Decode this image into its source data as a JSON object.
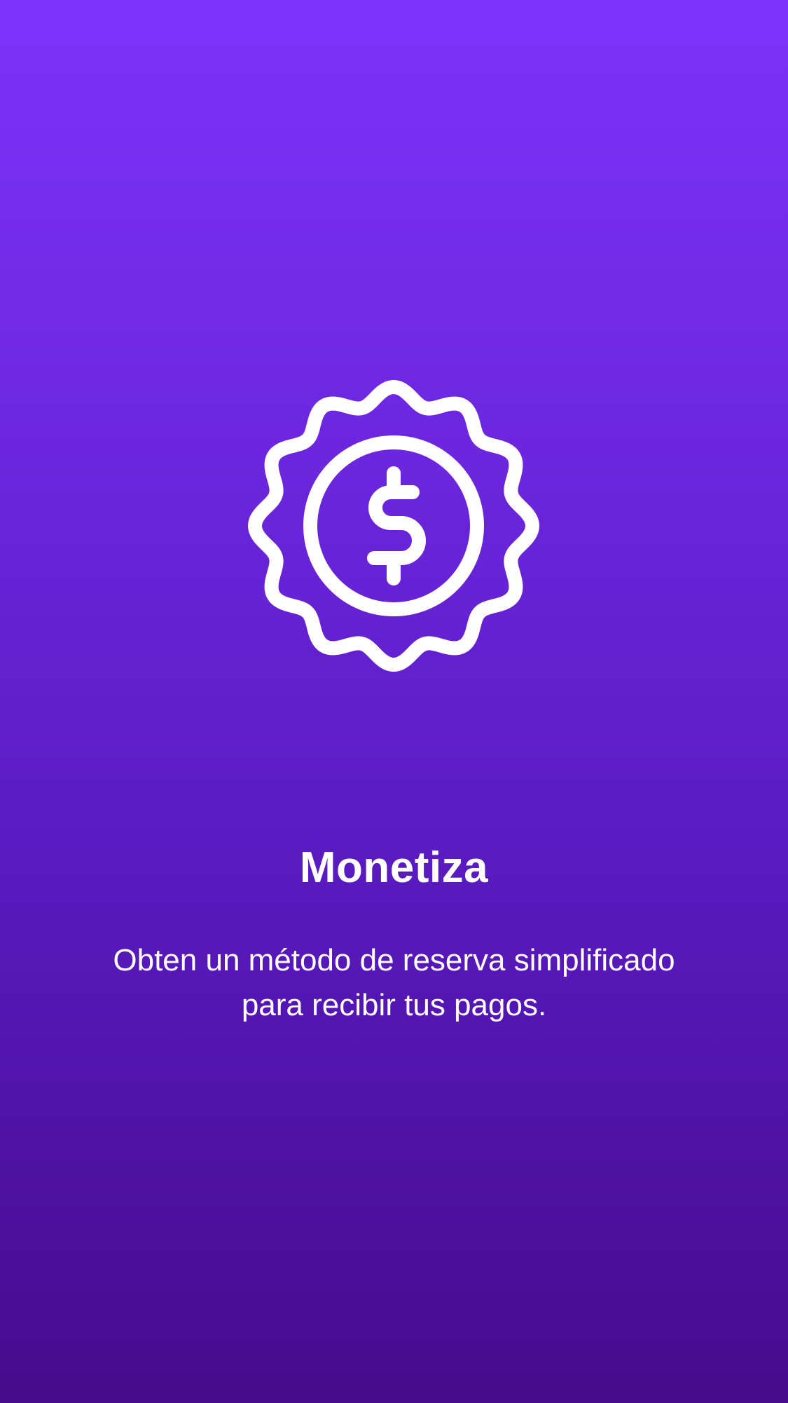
{
  "onboarding": {
    "icon": "dollar-badge-icon",
    "title": "Monetiza",
    "description": "Obten un método de reserva simplificado para recibir tus pagos."
  },
  "colors": {
    "gradient_top": "#7d33fa",
    "gradient_bottom": "#460b8c",
    "foreground": "#ffffff"
  }
}
